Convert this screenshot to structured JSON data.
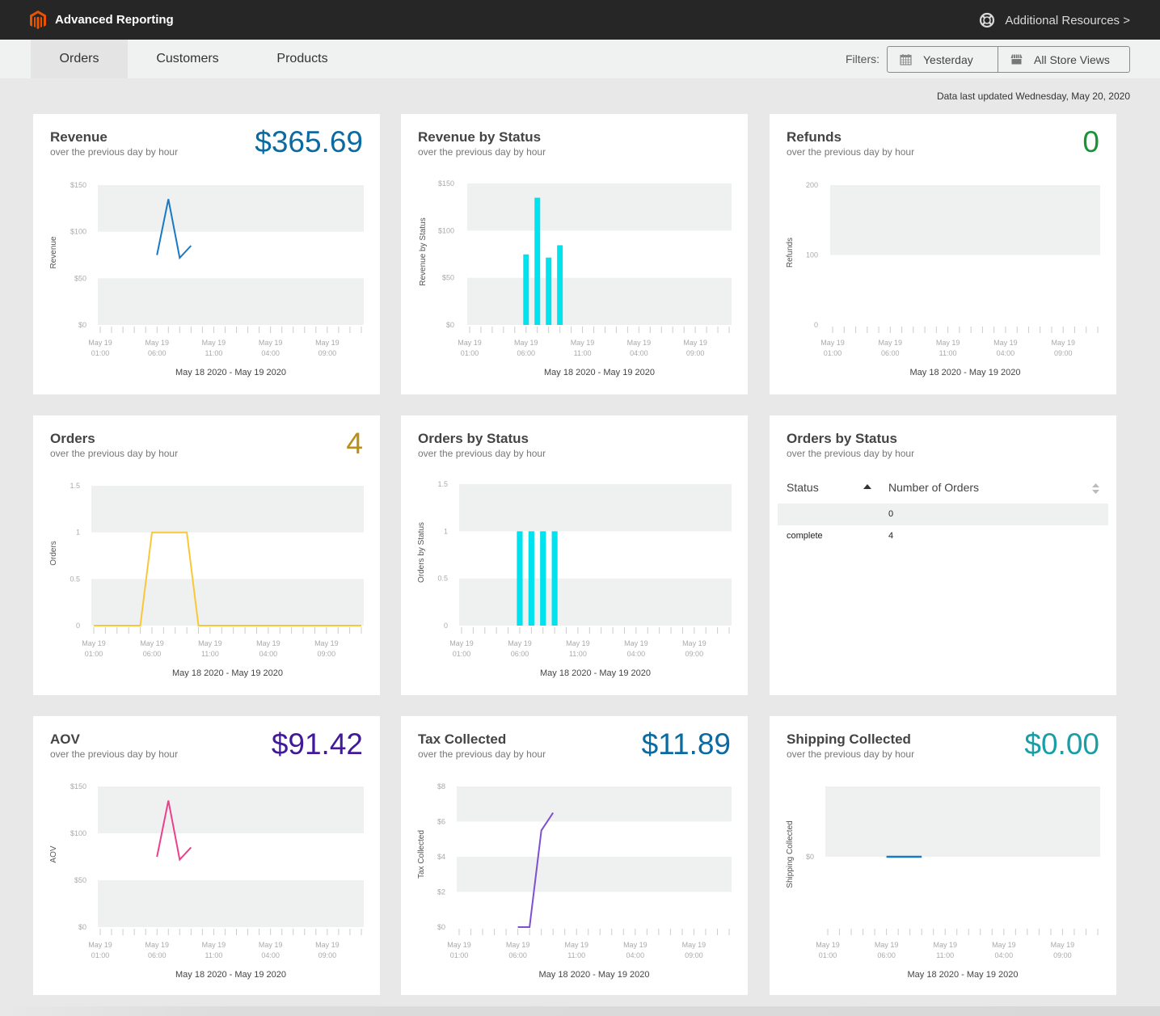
{
  "header": {
    "app_title": "Advanced Reporting",
    "resources_label": "Additional Resources >",
    "resources_icon": "lifebuoy-icon",
    "logo_icon": "magento-logo-icon",
    "brand_color": "#eb5202"
  },
  "nav": {
    "tabs": [
      {
        "label": "Orders",
        "active": true
      },
      {
        "label": "Customers",
        "active": false
      },
      {
        "label": "Products",
        "active": false
      }
    ],
    "filters_label": "Filters:",
    "date_filter": {
      "label": "Yesterday",
      "icon": "calendar-icon"
    },
    "store_filter": {
      "label": "All Store Views",
      "icon": "storefront-icon"
    }
  },
  "updated_text": "Data last updated Wednesday, May 20, 2020",
  "x_tick_labels": [
    {
      "line1": "May 19",
      "line2": "01:00"
    },
    {
      "line1": "May 19",
      "line2": "06:00"
    },
    {
      "line1": "May 19",
      "line2": "11:00"
    },
    {
      "line1": "May 19",
      "line2": "04:00"
    },
    {
      "line1": "May 19",
      "line2": "09:00"
    }
  ],
  "date_range": "May 18 2020 - May 19 2020",
  "cards": {
    "revenue": {
      "title": "Revenue",
      "subtitle": "over the previous day by hour",
      "value": "$365.69",
      "value_color": "#0a6aa1"
    },
    "revenue_status": {
      "title": "Revenue by Status",
      "subtitle": "over the previous day by hour"
    },
    "refunds": {
      "title": "Refunds",
      "subtitle": "over the previous day by hour",
      "value": "0",
      "value_color": "#1a9235"
    },
    "orders": {
      "title": "Orders",
      "subtitle": "over the previous day by hour",
      "value": "4",
      "value_color": "#b88f18"
    },
    "orders_status": {
      "title": "Orders by Status",
      "subtitle": "over the previous day by hour"
    },
    "orders_table": {
      "title": "Orders by Status",
      "subtitle": "over the previous day by hour",
      "columns": [
        "Status",
        "Number of Orders"
      ],
      "rows": [
        {
          "status": "",
          "count": "0"
        },
        {
          "status": "complete",
          "count": "4"
        }
      ]
    },
    "aov": {
      "title": "AOV",
      "subtitle": "over the previous day by hour",
      "value": "$91.42",
      "value_color": "#41199a"
    },
    "tax": {
      "title": "Tax Collected",
      "subtitle": "over the previous day by hour",
      "value": "$11.89",
      "value_color": "#0a6aa1"
    },
    "shipping": {
      "title": "Shipping Collected",
      "subtitle": "over the previous day by hour",
      "value": "$0.00",
      "value_color": "#1a9ea6"
    }
  },
  "chart_data": [
    {
      "id": "revenue",
      "type": "line",
      "title": "Revenue",
      "ylabel": "Revenue",
      "xlabel": "May 18 2020 - May 19 2020",
      "ylim": [
        0,
        150
      ],
      "yticks": [
        "$0",
        "$50",
        "$100",
        "$150"
      ],
      "ytick_values": [
        0,
        50,
        100,
        150
      ],
      "hours": 24,
      "color": "#1979c3",
      "points": [
        [
          5,
          75
        ],
        [
          6,
          135
        ],
        [
          7,
          72
        ],
        [
          8,
          85
        ]
      ]
    },
    {
      "id": "revenue_status",
      "type": "bar",
      "title": "Revenue by Status",
      "ylabel": "Revenue by Status",
      "xlabel": "May 18 2020 - May 19 2020",
      "ylim": [
        0,
        150
      ],
      "yticks": [
        "$0",
        "$50",
        "$100",
        "$150"
      ],
      "ytick_values": [
        0,
        50,
        100,
        150
      ],
      "hours": 24,
      "color": "#00e3ef",
      "points": [
        [
          5,
          74.8
        ],
        [
          6,
          134.9
        ],
        [
          7,
          71.4
        ],
        [
          8,
          84.5
        ]
      ]
    },
    {
      "id": "refunds",
      "type": "line",
      "title": "Refunds",
      "ylabel": "Refunds",
      "xlabel": "May 18 2020 - May 19 2020",
      "ylim": [
        0,
        200
      ],
      "yticks": [
        "0",
        "100",
        "200"
      ],
      "ytick_values": [
        0,
        100,
        200
      ],
      "hours": 24,
      "color": "#1979c3",
      "points": []
    },
    {
      "id": "orders",
      "type": "line",
      "title": "Orders",
      "ylabel": "Orders",
      "xlabel": "May 18 2020 - May 19 2020",
      "ylim": [
        0,
        1.5
      ],
      "yticks": [
        "0",
        "0.5",
        "1",
        "1.5"
      ],
      "ytick_values": [
        0,
        0.5,
        1,
        1.5
      ],
      "hours": 24,
      "color": "#f9c838",
      "points": [
        [
          0,
          0
        ],
        [
          1,
          0
        ],
        [
          2,
          0
        ],
        [
          3,
          0
        ],
        [
          4,
          0
        ],
        [
          5,
          1
        ],
        [
          6,
          1
        ],
        [
          7,
          1
        ],
        [
          8,
          1
        ],
        [
          9,
          0
        ],
        [
          10,
          0
        ],
        [
          11,
          0
        ],
        [
          12,
          0
        ],
        [
          13,
          0
        ],
        [
          14,
          0
        ],
        [
          15,
          0
        ],
        [
          16,
          0
        ],
        [
          17,
          0
        ],
        [
          18,
          0
        ],
        [
          19,
          0
        ],
        [
          20,
          0
        ],
        [
          21,
          0
        ],
        [
          22,
          0
        ],
        [
          23,
          0
        ]
      ]
    },
    {
      "id": "orders_status",
      "type": "bar",
      "title": "Orders by Status",
      "ylabel": "Orders by Status",
      "xlabel": "May 18 2020 - May 19 2020",
      "ylim": [
        0,
        1.5
      ],
      "yticks": [
        "0",
        "0.5",
        "1",
        "1.5"
      ],
      "ytick_values": [
        0,
        0.5,
        1,
        1.5
      ],
      "hours": 24,
      "color": "#00e3ef",
      "points": [
        [
          5,
          1
        ],
        [
          6,
          1
        ],
        [
          7,
          1
        ],
        [
          8,
          1
        ]
      ]
    },
    {
      "id": "aov",
      "type": "line",
      "title": "AOV",
      "ylabel": "AOV",
      "xlabel": "May 18 2020 - May 19 2020",
      "ylim": [
        0,
        150
      ],
      "yticks": [
        "$0",
        "$50",
        "$100",
        "$150"
      ],
      "ytick_values": [
        0,
        50,
        100,
        150
      ],
      "hours": 24,
      "color": "#ec3f8c",
      "points": [
        [
          5,
          75
        ],
        [
          6,
          135
        ],
        [
          7,
          72
        ],
        [
          8,
          85
        ]
      ]
    },
    {
      "id": "tax",
      "type": "line",
      "title": "Tax Collected",
      "ylabel": "Tax Collected",
      "xlabel": "May 18 2020 - May 19 2020",
      "ylim": [
        0,
        8
      ],
      "yticks": [
        "$0",
        "$2",
        "$4",
        "$6",
        "$8"
      ],
      "ytick_values": [
        0,
        2,
        4,
        6,
        8
      ],
      "hours": 24,
      "color": "#7e4fd0",
      "points": [
        [
          5,
          0
        ],
        [
          6,
          0
        ],
        [
          7,
          5.5
        ],
        [
          8,
          6.5
        ]
      ]
    },
    {
      "id": "shipping",
      "type": "line",
      "title": "Shipping Collected",
      "ylabel": "Shipping Collected",
      "xlabel": "May 18 2020 - May 19 2020",
      "ylim": [
        -1,
        1
      ],
      "yticks": [
        "$0"
      ],
      "ytick_values": [
        0
      ],
      "hours": 24,
      "color": "#1979c3",
      "points": [
        [
          5,
          0
        ],
        [
          6,
          0
        ],
        [
          7,
          0
        ],
        [
          8,
          0
        ]
      ]
    }
  ]
}
